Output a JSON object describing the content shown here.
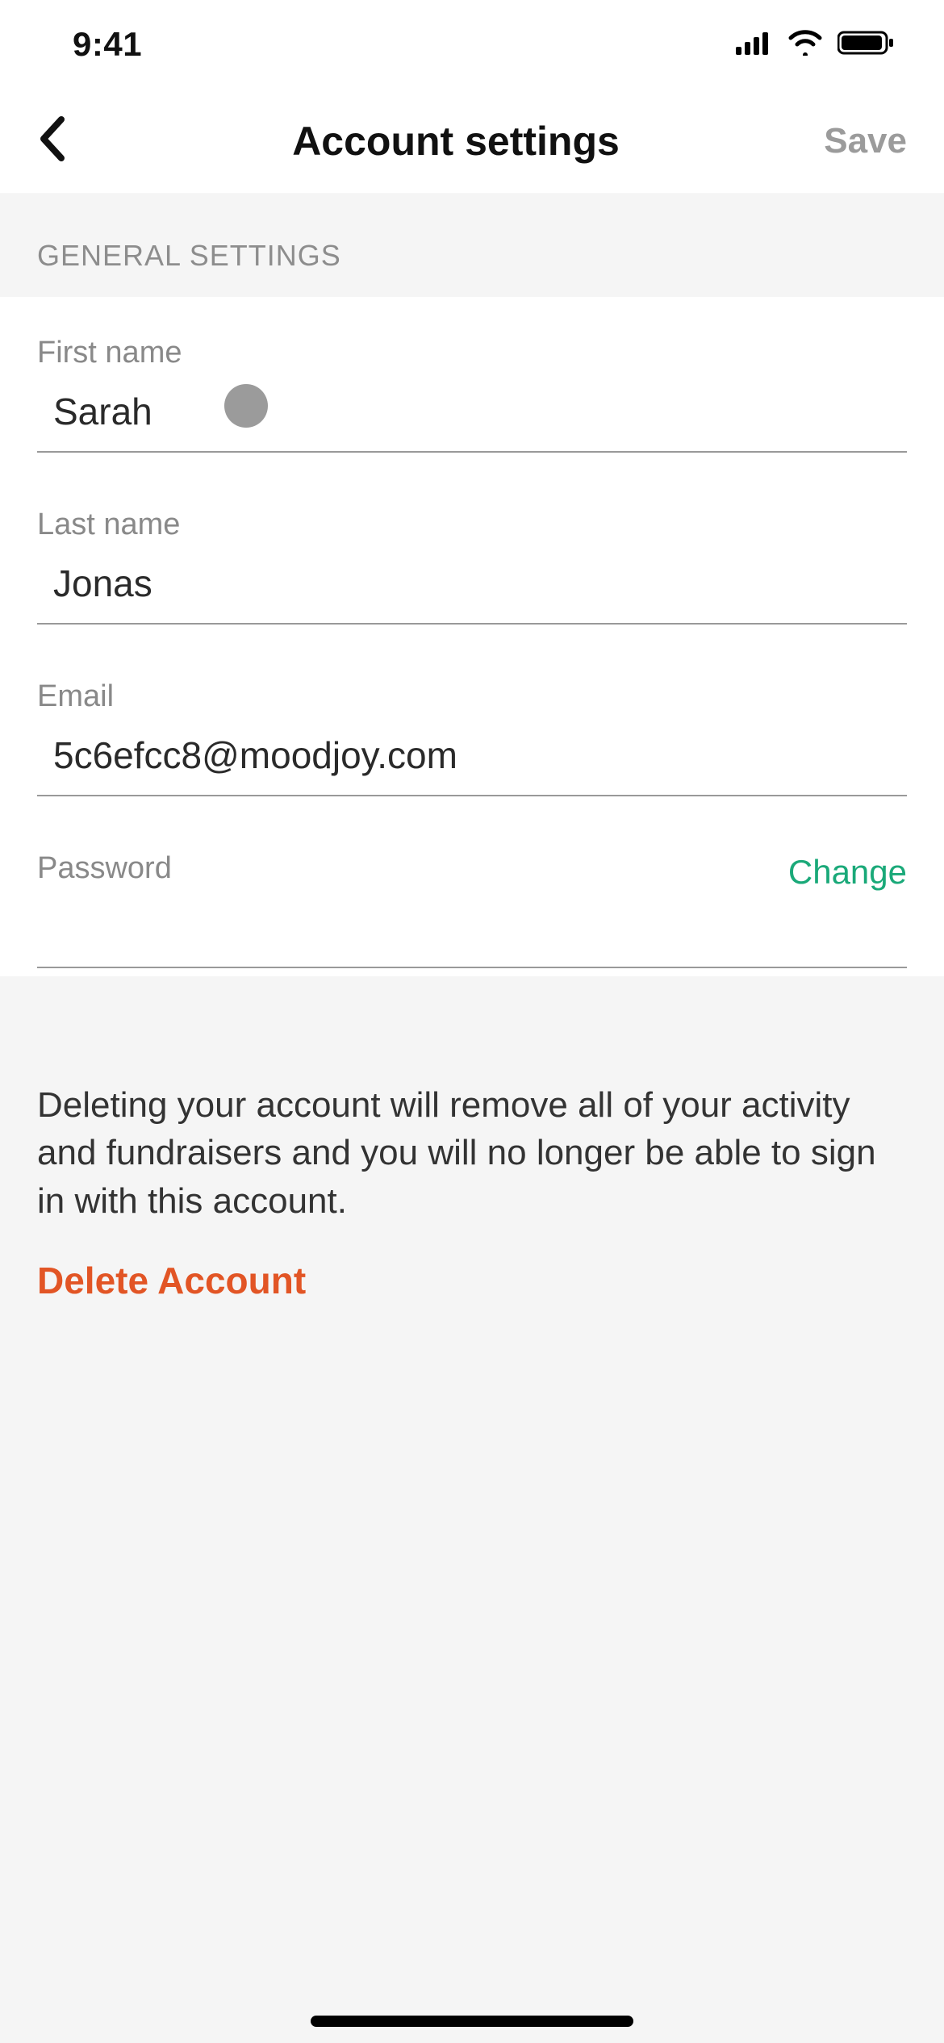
{
  "status": {
    "time": "9:41"
  },
  "nav": {
    "title": "Account settings",
    "save": "Save"
  },
  "section_header": "GENERAL SETTINGS",
  "fields": {
    "first_name": {
      "label": "First name",
      "value": "Sarah"
    },
    "last_name": {
      "label": "Last name",
      "value": "Jonas"
    },
    "email": {
      "label": "Email",
      "value": "5c6efcc8@moodjoy.com"
    },
    "password": {
      "label": "Password",
      "value": "",
      "change": "Change"
    }
  },
  "delete": {
    "text": "Deleting your account will remove all of your activity and fundraisers and you will no longer be able to sign in with this account.",
    "button": "Delete Account"
  },
  "colors": {
    "accent_green": "#1aa979",
    "accent_red": "#e25525",
    "muted": "#9b9b9b"
  }
}
